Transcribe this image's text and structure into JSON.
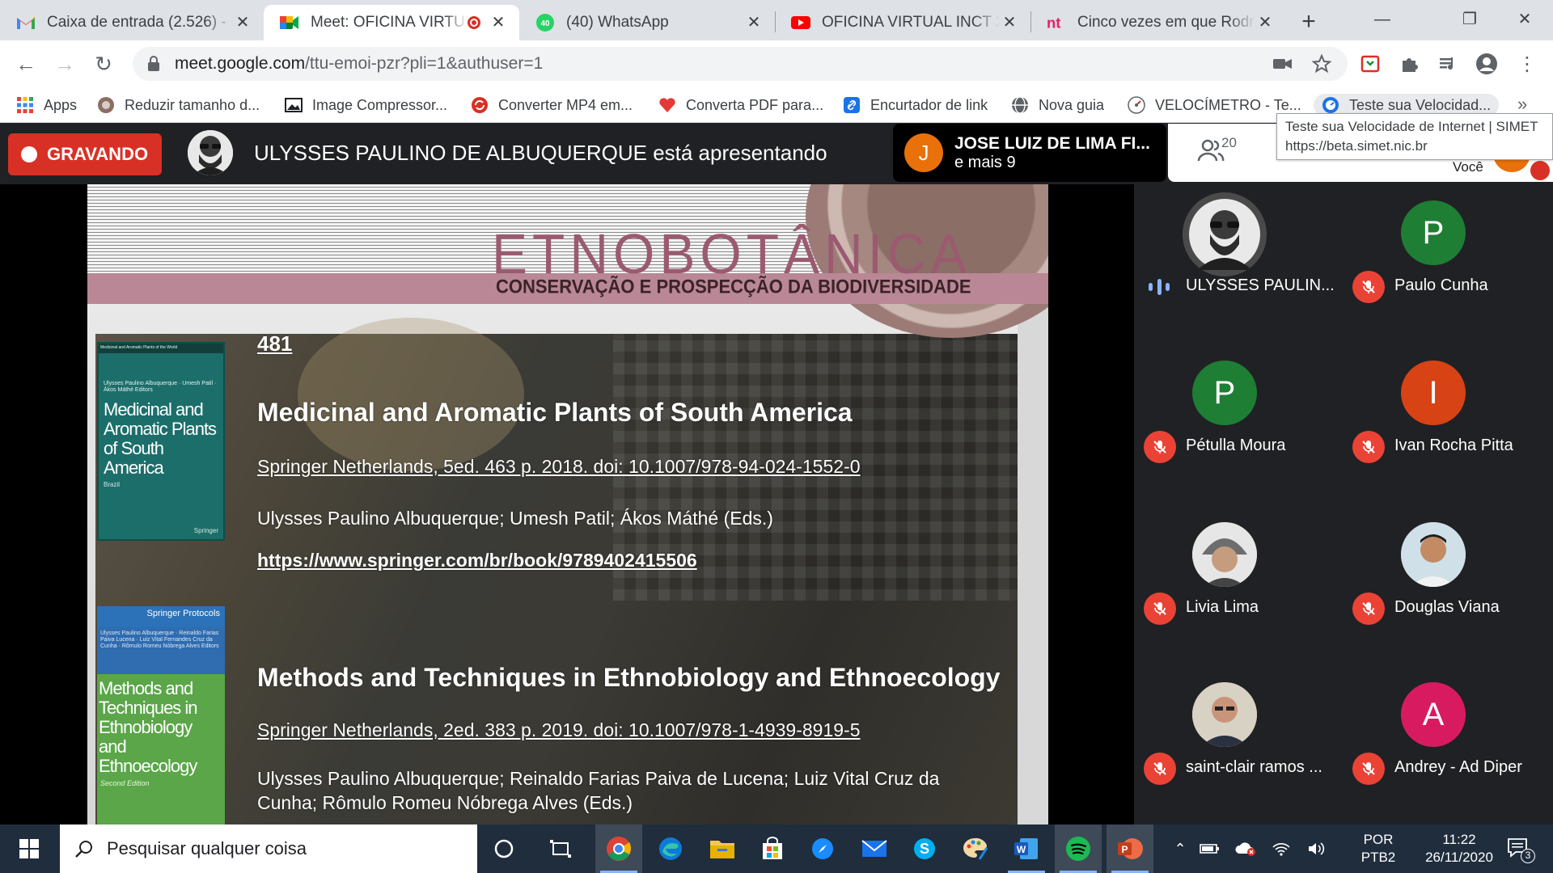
{
  "browser": {
    "tabs": [
      {
        "title": "Caixa de entrada (2.526) - d",
        "icon": "gmail-icon"
      },
      {
        "title": "Meet: OFICINA VIRTUA",
        "icon": "meet-icon",
        "active": true,
        "recording": true
      },
      {
        "title": "(40) WhatsApp",
        "icon": "whatsapp-icon"
      },
      {
        "title": "OFICINA VIRTUAL INCT 202",
        "icon": "youtube-icon"
      },
      {
        "title": "Cinco vezes em que Rodrig",
        "icon": "nt-icon"
      }
    ],
    "url_host": "meet.google.com",
    "url_path": "/ttu-emoi-pzr?pli=1&authuser=1",
    "bookmarks": [
      {
        "label": "Apps",
        "icon": "apps-grid-icon"
      },
      {
        "label": "Reduzir tamanho d...",
        "icon": "reduce-icon"
      },
      {
        "label": "Image Compressor...",
        "icon": "image-icon"
      },
      {
        "label": "Converter MP4 em...",
        "icon": "convert-icon"
      },
      {
        "label": "Converta PDF para...",
        "icon": "heart-icon"
      },
      {
        "label": "Encurtador de link",
        "icon": "link-icon"
      },
      {
        "label": "Nova guia",
        "icon": "globe-icon"
      },
      {
        "label": "VELOCÍMETRO - Te...",
        "icon": "speedometer-icon"
      },
      {
        "label": "Teste sua Velocidad...",
        "icon": "speedtest-icon"
      }
    ],
    "tooltip_title": "Teste sua Velocidade de Internet | SIMET",
    "tooltip_url": "https://beta.simet.nic.br"
  },
  "meet": {
    "recording_label": "GRAVANDO",
    "presenter_text": "ULYSSES PAULINO DE ALBUQUERQUE está apresentando",
    "join_initial": "J",
    "join_name": "JOSE LUIZ DE LIMA FI...",
    "join_more": "e mais 9",
    "participant_count": "20",
    "you_label": "Você",
    "participants": [
      {
        "name": "ULYSSES PAULIN...",
        "initial": "",
        "color": "#3c4043",
        "speaking": true
      },
      {
        "name": "Paulo Cunha",
        "initial": "P",
        "color": "#1e7e34"
      },
      {
        "name": "Pétulla Moura",
        "initial": "P",
        "color": "#1e7e34"
      },
      {
        "name": "Ivan Rocha Pitta",
        "initial": "I",
        "color": "#d84315"
      },
      {
        "name": "Livia Lima",
        "initial": "",
        "color": "#c9b8a6"
      },
      {
        "name": "Douglas Viana",
        "initial": "",
        "color": "#d9c7a8"
      },
      {
        "name": "saint-clair ramos ...",
        "initial": "",
        "color": "#bfa78a"
      },
      {
        "name": "Andrey - Ad Diper",
        "initial": "A",
        "color": "#d81b60"
      }
    ]
  },
  "slide": {
    "brand_title": "ETNOBOTÂNICA",
    "brand_subtitle_a": "CONSERVAÇÃO E PROSPECÇÃO DA ",
    "brand_subtitle_b": "BIODIVERSIDADE",
    "page_ref": "481",
    "book1": {
      "series": "Medicinal and Aromatic Plants of the World",
      "editors": "Ulysses Paulino Albuquerque · Umesh Patil · Ákos Máthé  Editors",
      "cover_title": "Medicinal and Aromatic Plants of South America",
      "cover_sub": "Brazil",
      "publisher": "Springer",
      "heading": "Medicinal and Aromatic Plants of South America",
      "reference": "Springer Netherlands, 5ed. 463 p. 2018. doi: 10.1007/978-94-024-1552-0",
      "authors": "Ulysses Paulino Albuquerque; Umesh Patil; Ákos Máthé (Eds.)",
      "link": "https://www.springer.com/br/book/9789402415506"
    },
    "book2": {
      "series": "Springer Protocols",
      "editors": "Ulysses Paulino Albuquerque · Reinaldo Farias Paiva Lucena · Luiz Vital Fernandes Cruz da Cunha · Rômulo Romeu Nóbrega Alves  Editors",
      "cover_title": "Methods and Techniques in Ethnobiology and Ethnoecology",
      "edition": "Second Edition",
      "heading": "Methods and Techniques in Ethnobiology and Ethnoecology",
      "reference": "Springer Netherlands, 2ed. 383 p. 2019. doi: 10.1007/978-1-4939-8919-5",
      "authors_line1": "Ulysses  Paulino  Albuquerque;  Reinaldo  Farias  Paiva  de  Lucena;  Luiz  Vital  Cruz  da",
      "authors_line2": "Cunha; Rômulo Romeu Nóbrega Alves (Eds.)"
    }
  },
  "taskbar": {
    "search_placeholder": "Pesquisar qualquer coisa",
    "lang_line1": "POR",
    "lang_line2": "PTB2",
    "time": "11:22",
    "date": "26/11/2020",
    "notification_count": "3"
  }
}
